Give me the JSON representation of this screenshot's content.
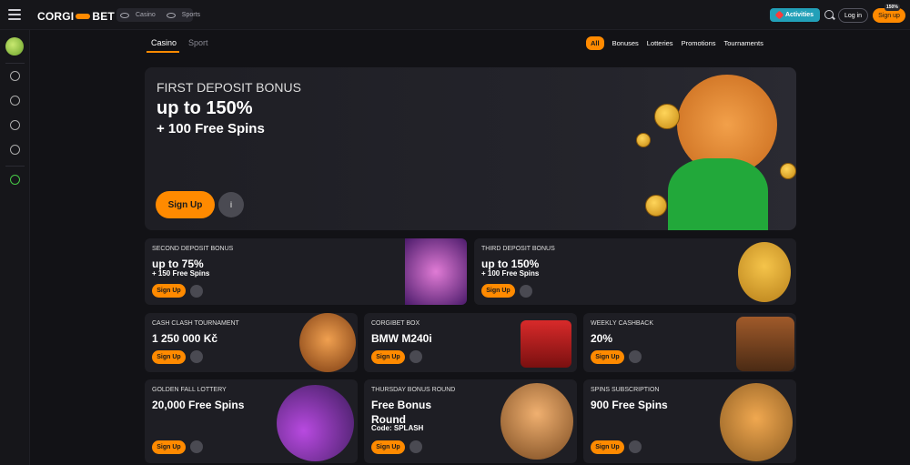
{
  "header": {
    "logo_left": "CORGI",
    "logo_right": "BET",
    "tabs": [
      {
        "label": "Casino",
        "icon": "cherries-icon"
      },
      {
        "label": "Sports",
        "icon": "soccer-ball-icon"
      }
    ],
    "activities_label": "Activities",
    "login_label": "Log in",
    "signup_label": "Sign up",
    "signup_badge": "150%"
  },
  "nav": {
    "tabs": [
      "Casino",
      "Sport"
    ],
    "filters": [
      "All",
      "Bonuses",
      "Lotteries",
      "Promotions",
      "Tournaments"
    ]
  },
  "hero": {
    "title": "FIRST DEPOSIT BONUS",
    "headline": "up to 150%",
    "sub": "+ 100 Free Spins",
    "button": "Sign Up",
    "info": "i"
  },
  "cards_row1": [
    {
      "label": "SECOND DEPOSIT BONUS",
      "headline": "up to 75%",
      "sub": "+ 150 Free Spins",
      "button": "Sign Up"
    },
    {
      "label": "THIRD DEPOSIT BONUS",
      "headline": "up to 150%",
      "sub": "+ 100 Free Spins",
      "button": "Sign Up"
    }
  ],
  "cards_row2": [
    {
      "label": "CASH CLASH TOURNAMENT",
      "headline": "1 250 000 Kč",
      "button": "Sign Up"
    },
    {
      "label": "CORGIBET BOX",
      "headline": "BMW M240i",
      "button": "Sign Up"
    },
    {
      "label": "WEEKLY CASHBACK",
      "headline": "20%",
      "button": "Sign Up"
    }
  ],
  "cards_row3": [
    {
      "label": "GOLDEN FALL LOTTERY",
      "headline": "20,000 Free Spins",
      "button": "Sign Up"
    },
    {
      "label": "THURSDAY BONUS ROUND",
      "headline": "Free Bonus Round",
      "sub": "Code: SPLASH",
      "button": "Sign Up"
    },
    {
      "label": "SPINS SUBSCRIPTION",
      "headline": "900 Free Spins",
      "button": "Sign Up"
    }
  ],
  "colors": {
    "accent": "#ff8a00",
    "activities": "#22a0b8",
    "background": "#121216",
    "card": "#1e1e24"
  }
}
